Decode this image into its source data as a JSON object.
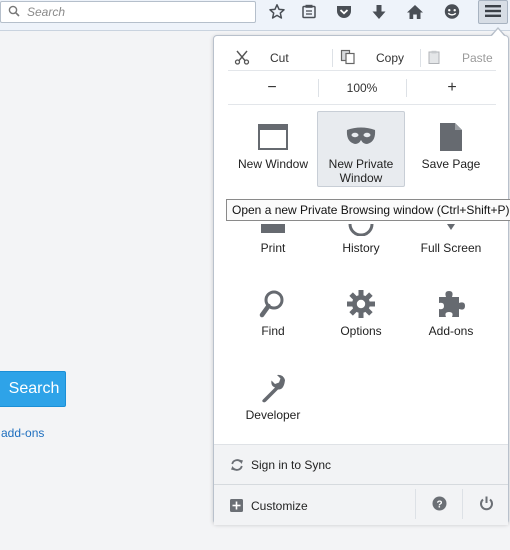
{
  "toolbar": {
    "search_placeholder": "Search",
    "icons": [
      "star-icon",
      "reading-list-icon",
      "pocket-icon",
      "download-icon",
      "home-icon",
      "chat-icon",
      "hamburger-menu-icon"
    ]
  },
  "page": {
    "search_button": "Search",
    "link": "add-ons"
  },
  "menu": {
    "edit": {
      "cut": "Cut",
      "copy": "Copy",
      "paste": "Paste"
    },
    "zoom": {
      "minus": "−",
      "level": "100%",
      "plus": "+"
    },
    "items": [
      {
        "label": "New Window",
        "icon": "window-icon"
      },
      {
        "label": "New Private Window",
        "icon": "mask-icon"
      },
      {
        "label": "Save Page",
        "icon": "page-icon"
      },
      {
        "label": "Print",
        "icon": "printer-icon"
      },
      {
        "label": "History",
        "icon": "clock-icon"
      },
      {
        "label": "Full Screen",
        "icon": "fullscreen-icon"
      },
      {
        "label": "Find",
        "icon": "magnifier-icon"
      },
      {
        "label": "Options",
        "icon": "gear-icon"
      },
      {
        "label": "Add-ons",
        "icon": "puzzle-icon"
      },
      {
        "label": "Developer",
        "icon": "wrench-icon"
      }
    ],
    "sync": "Sign in to Sync",
    "customize": "Customize"
  },
  "tooltip": "Open a new Private Browsing window (Ctrl+Shift+P)",
  "colors": {
    "accent": "#2ea3e8",
    "link": "#1e6fbf",
    "icon": "#666a70"
  }
}
